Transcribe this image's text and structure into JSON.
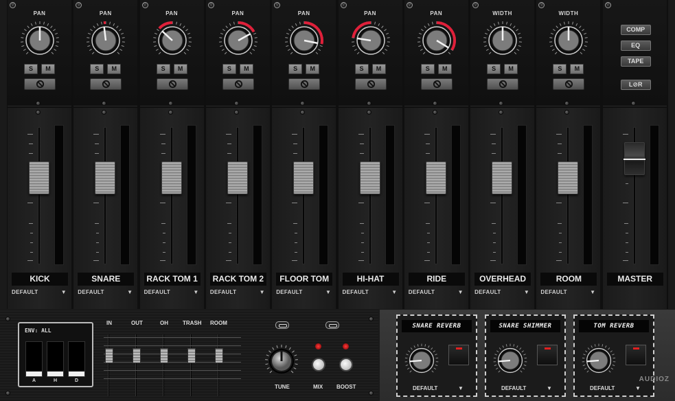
{
  "channels": [
    {
      "top_label": "PAN",
      "name": "KICK",
      "preset": "DEFAULT",
      "solo": "S",
      "mute": "M",
      "knob": 0.0
    },
    {
      "top_label": "PAN",
      "name": "SNARE",
      "preset": "DEFAULT",
      "solo": "S",
      "mute": "M",
      "knob": -0.05
    },
    {
      "top_label": "PAN",
      "name": "RACK TOM 1",
      "preset": "DEFAULT",
      "solo": "S",
      "mute": "M",
      "knob": -0.35
    },
    {
      "top_label": "PAN",
      "name": "RACK TOM 2",
      "preset": "DEFAULT",
      "solo": "S",
      "mute": "M",
      "knob": 0.45
    },
    {
      "top_label": "PAN",
      "name": "FLOOR TOM",
      "preset": "DEFAULT",
      "solo": "S",
      "mute": "M",
      "knob": 0.75
    },
    {
      "top_label": "PAN",
      "name": "HI-HAT",
      "preset": "DEFAULT",
      "solo": "S",
      "mute": "M",
      "knob": -0.6
    },
    {
      "top_label": "PAN",
      "name": "RIDE",
      "preset": "DEFAULT",
      "solo": "S",
      "mute": "M",
      "knob": 0.9
    },
    {
      "top_label": "WIDTH",
      "name": "OVERHEAD",
      "preset": "DEFAULT",
      "solo": "S",
      "mute": "M",
      "knob": 0.0
    },
    {
      "top_label": "WIDTH",
      "name": "ROOM",
      "preset": "DEFAULT",
      "solo": "S",
      "mute": "M",
      "knob": 0.0
    }
  ],
  "master": {
    "name": "MASTER",
    "buttons": [
      "COMP",
      "EQ",
      "TAPE",
      "L⊘R"
    ]
  },
  "envelope": {
    "title": "ENV: ALL",
    "slots": [
      "A",
      "H",
      "D"
    ]
  },
  "mini_faders": [
    "IN",
    "OUT",
    "OH",
    "TRASH",
    "ROOM"
  ],
  "tune_label": "TUNE",
  "mix_label": "MIX",
  "boost_label": "BOOST",
  "reverbs": [
    {
      "title": "SNARE REVERB",
      "preset": "DEFAULT"
    },
    {
      "title": "SNARE SHIMMER",
      "preset": "DEFAULT"
    },
    {
      "title": "TOM REVERB",
      "preset": "DEFAULT"
    }
  ],
  "colors": {
    "accent_red": "#e0203a",
    "led_red": "#ff3a3a"
  },
  "watermark": "AUDIOZ"
}
